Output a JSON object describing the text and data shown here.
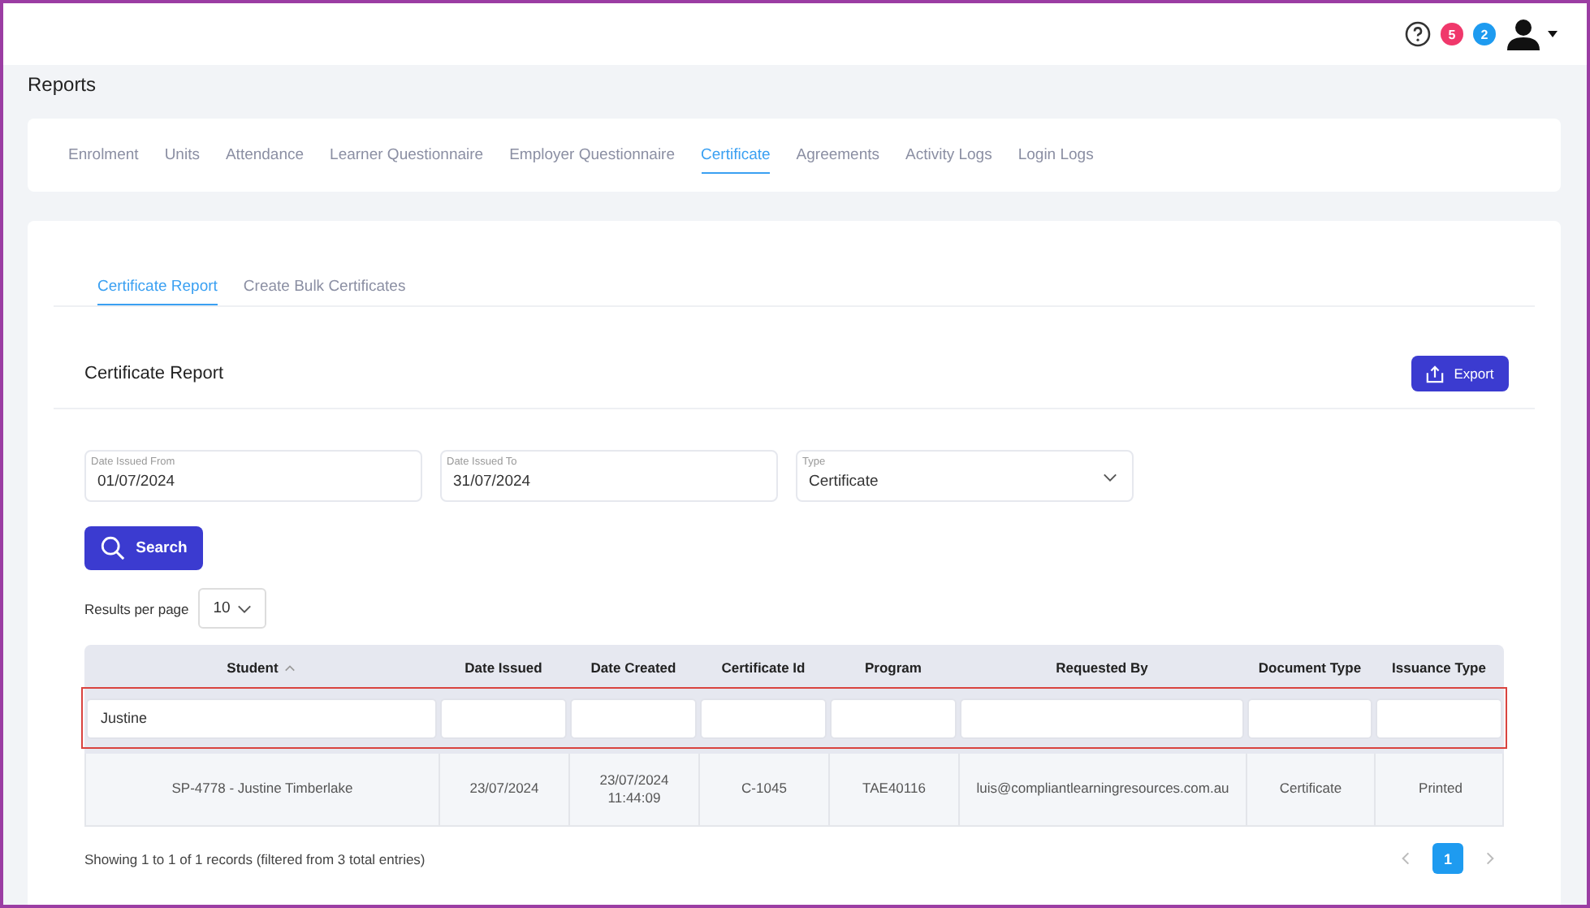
{
  "topbar": {
    "badges": [
      {
        "count": "5",
        "color": "#f0386b"
      },
      {
        "count": "2",
        "color": "#1e9bf0"
      }
    ]
  },
  "page_title": "Reports",
  "tabs": [
    {
      "label": "Enrolment",
      "selected": false
    },
    {
      "label": "Units",
      "selected": false
    },
    {
      "label": "Attendance",
      "selected": false
    },
    {
      "label": "Learner Questionnaire",
      "selected": false
    },
    {
      "label": "Employer Questionnaire",
      "selected": false
    },
    {
      "label": "Certificate",
      "selected": true
    },
    {
      "label": "Agreements",
      "selected": false
    },
    {
      "label": "Activity Logs",
      "selected": false
    },
    {
      "label": "Login Logs",
      "selected": false
    }
  ],
  "subtabs": [
    {
      "label": "Certificate Report",
      "selected": true
    },
    {
      "label": "Create Bulk Certificates",
      "selected": false
    }
  ],
  "report": {
    "title": "Certificate Report",
    "export_button": "Export",
    "filters": [
      {
        "kind": "date",
        "label": "Date Issued From",
        "value": "01/07/2024"
      },
      {
        "kind": "date",
        "label": "Date Issued To",
        "value": "31/07/2024"
      },
      {
        "kind": "select",
        "label": "Type",
        "value": "Certificate"
      }
    ],
    "search_button": "Search",
    "results_per_page": {
      "label": "Results per page",
      "value": "10"
    },
    "table": {
      "columns": [
        {
          "label": "Student",
          "sorted": true
        },
        {
          "label": "Date Issued",
          "sorted": false
        },
        {
          "label": "Date Created",
          "sorted": false
        },
        {
          "label": "Certificate Id",
          "sorted": false
        },
        {
          "label": "Program",
          "sorted": false
        },
        {
          "label": "Requested By",
          "sorted": false
        },
        {
          "label": "Document Type",
          "sorted": false
        },
        {
          "label": "Issuance Type",
          "sorted": false
        }
      ],
      "filter_row_highlighted": true,
      "filter_values": [
        "Justine"
      ],
      "rows": [
        [
          "SP-4778 - Justine Timberlake",
          "23/07/2024",
          "23/07/2024 11:44:09",
          "C-1045",
          "TAE40116",
          "luis@compliantlearningresources.com.au",
          "Certificate",
          "Printed"
        ]
      ]
    },
    "info": "Showing 1 to 1 of 1 records (filtered from 3 total entries)",
    "pages": [
      {
        "label": "1",
        "selected": true
      }
    ]
  }
}
